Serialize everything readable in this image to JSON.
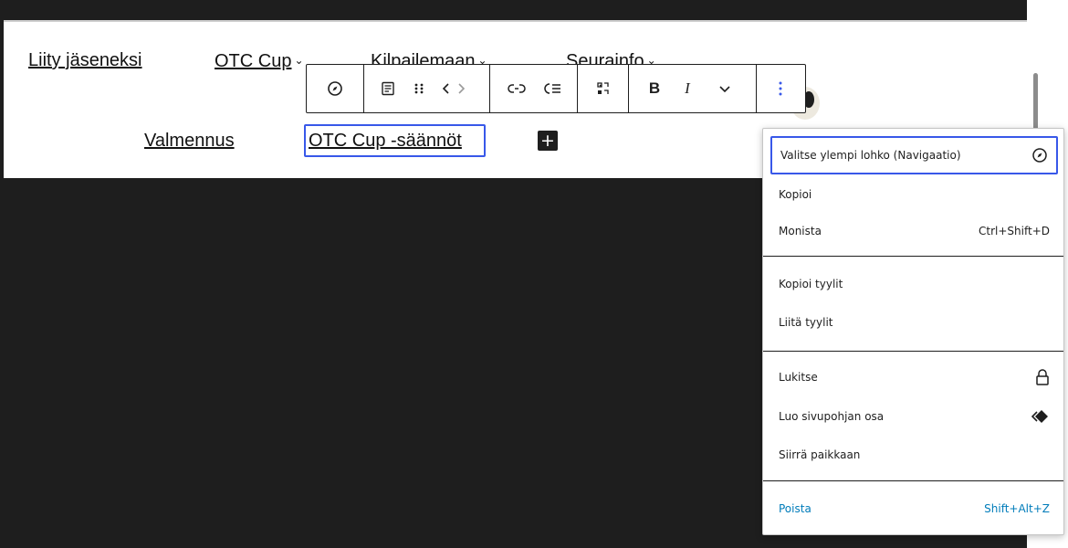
{
  "nav": {
    "row1": [
      {
        "label": "Liity jäseneksi",
        "chevron": false
      },
      {
        "label": "OTC Cup",
        "chevron": true
      },
      {
        "label": "Kilpailemaan",
        "chevron": true
      },
      {
        "label": "Seurainfo",
        "chevron": true
      }
    ],
    "valmennus": "Valmennus",
    "current": "OTC Cup -säännöt",
    "chevron_glyph": "⌄",
    "add_glyph": "+"
  },
  "toolbar": {
    "bold_label": "B",
    "italic_label": "I",
    "icons": [
      "compass-icon",
      "paragraph-icon",
      "drag-handle-icon",
      "move-arrows-icon",
      "unlink-icon",
      "list-indent-icon",
      "submenu-icon",
      "bold-icon",
      "italic-icon",
      "chevron-down-icon",
      "more-options-icon"
    ]
  },
  "menu": {
    "group1": [
      {
        "label": "Valitse ylempi lohko (Navigaatio)",
        "shortcut": "",
        "icon": "compass-icon"
      },
      {
        "label": "Kopioi",
        "shortcut": ""
      },
      {
        "label": "Monista",
        "shortcut": "Ctrl+Shift+D"
      }
    ],
    "group2": [
      {
        "label": "Kopioi tyylit",
        "shortcut": ""
      },
      {
        "label": "Liitä tyylit",
        "shortcut": ""
      }
    ],
    "group3": [
      {
        "label": "Lukitse",
        "shortcut": "",
        "icon": "lock-icon"
      },
      {
        "label": "Luo sivupohjan osa",
        "shortcut": "",
        "icon": "template-part-icon"
      },
      {
        "label": "Siirrä paikkaan",
        "shortcut": ""
      }
    ],
    "delete": {
      "label": "Poista",
      "shortcut": "Shift+Alt+Z"
    }
  },
  "colors": {
    "accent": "#3858e9",
    "delete": "#007cba",
    "dark": "#1e1e1e"
  }
}
